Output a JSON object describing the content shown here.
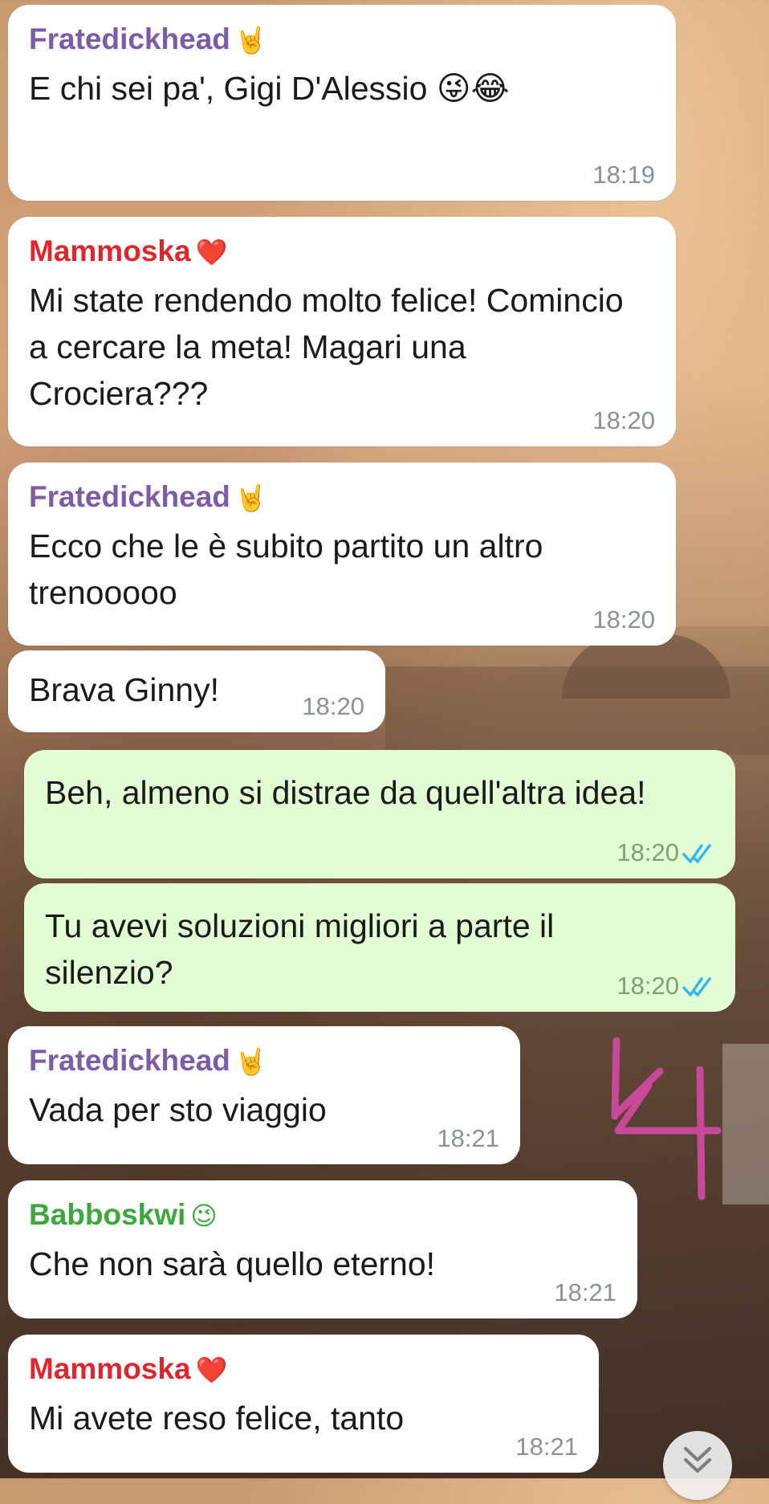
{
  "messages": [
    {
      "sender": "Fratedickhead",
      "sender_emoji": "🤘",
      "text": "E chi sei pa', Gigi D'Alessio 😜😂",
      "time": "18:19"
    },
    {
      "sender": "Mammoska",
      "sender_emoji": "❤️",
      "text": "Mi state rendendo molto felice! Comincio a cercare la meta! Magari una Crociera???",
      "time": "18:20"
    },
    {
      "sender": "Fratedickhead",
      "sender_emoji": "🤘",
      "text": "Ecco che le è subito partito un altro trenooooo",
      "time": "18:20"
    },
    {
      "text": "Brava Ginny!",
      "time": "18:20"
    },
    {
      "text": "Beh, almeno si distrae da quell'altra idea!",
      "time": "18:20"
    },
    {
      "text": "Tu avevi soluzioni migliori a parte il silenzio?",
      "time": "18:20"
    },
    {
      "sender": "Fratedickhead",
      "sender_emoji": "🤘",
      "text": "Vada per sto viaggio",
      "time": "18:21"
    },
    {
      "sender": "Babboskwi",
      "sender_emoji": "😉",
      "text": "Che non sarà quello eterno!",
      "time": "18:21"
    },
    {
      "sender": "Mammoska",
      "sender_emoji": "❤️",
      "text": "Mi avete reso felice, tanto",
      "time": "18:21"
    }
  ],
  "colors": {
    "fratedickhead": "#7d5ba6",
    "mammoska": "#e0262d",
    "babboskwi": "#3aa83a",
    "incoming_bubble": "#ffffff",
    "outgoing_bubble": "#e2fdd4",
    "read_ticks": "#34b7f1",
    "handwriting": "#c8489a"
  },
  "icons": {
    "read_receipt": "double-check-icon",
    "scroll_down": "chevron-double-down-icon"
  }
}
